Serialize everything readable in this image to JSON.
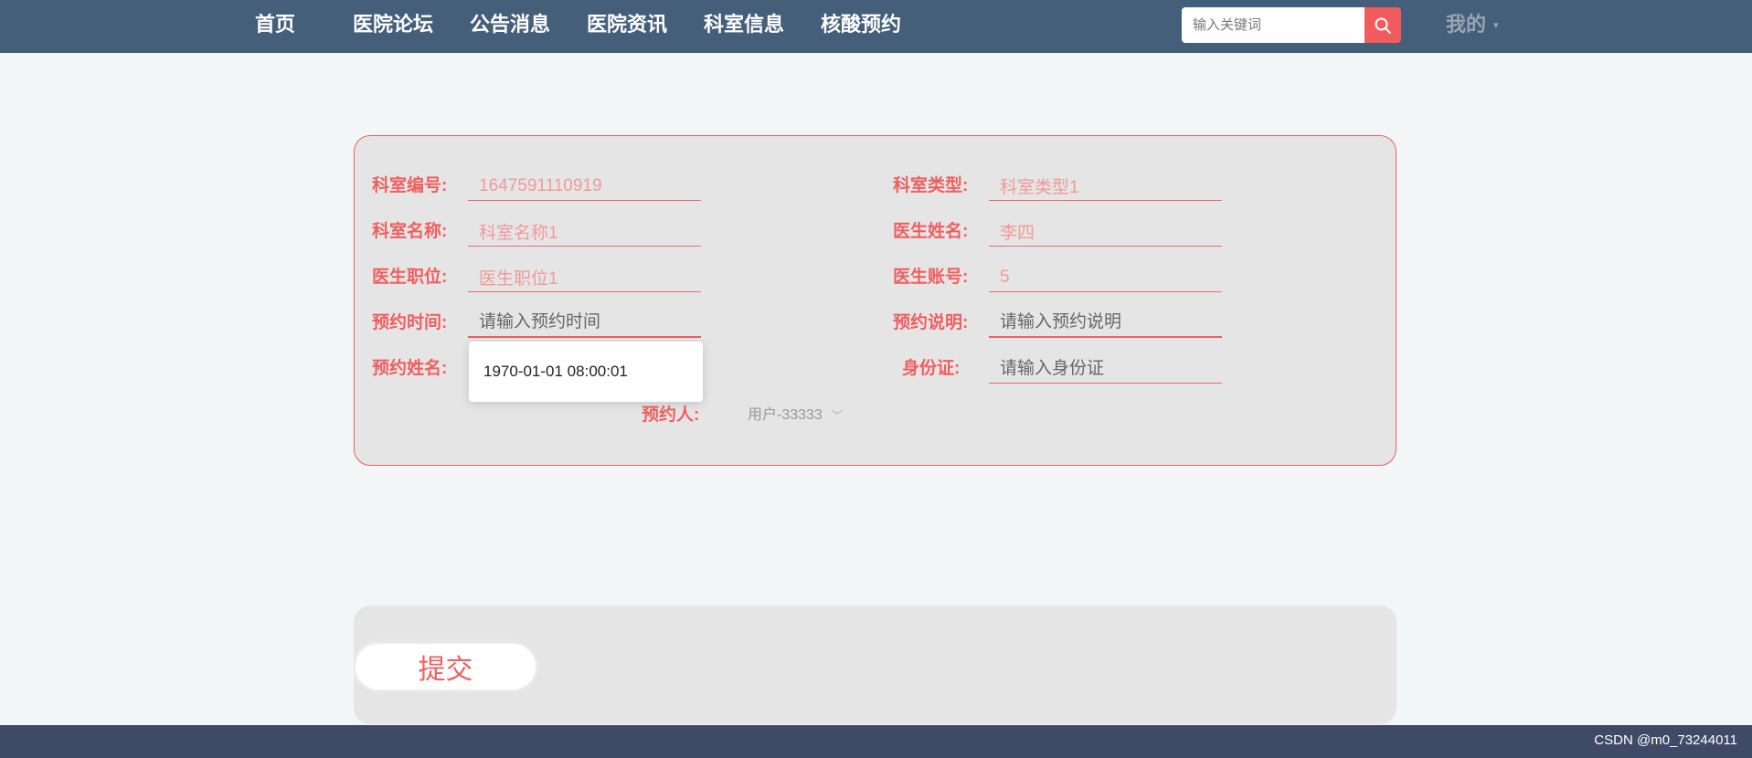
{
  "nav": {
    "items": [
      {
        "id": "home",
        "label": "首页"
      },
      {
        "id": "forum",
        "label": "医院论坛"
      },
      {
        "id": "notice",
        "label": "公告消息"
      },
      {
        "id": "news",
        "label": "医院资讯"
      },
      {
        "id": "department",
        "label": "科室信息"
      },
      {
        "id": "nucleic",
        "label": "核酸预约"
      }
    ],
    "search_placeholder": "输入关键词",
    "search_icon": "search-icon",
    "my_label": "我的",
    "my_caret": "▾"
  },
  "form": {
    "dept_no": {
      "label": "科室编号:",
      "value": "1647591110919"
    },
    "dept_type": {
      "label": "科室类型:",
      "value": "科室类型1"
    },
    "dept_name": {
      "label": "科室名称:",
      "value": "科室名称1"
    },
    "doctor_name": {
      "label": "医生姓名:",
      "value": "李四"
    },
    "doctor_title": {
      "label": "医生职位:",
      "value": "医生职位1"
    },
    "doctor_account": {
      "label": "医生账号:",
      "value": "5"
    },
    "appt_time": {
      "label": "预约时间:",
      "placeholder": "请输入预约时间"
    },
    "appt_desc": {
      "label": "预约说明:",
      "placeholder": "请输入预约说明"
    },
    "appt_name": {
      "label": "预约姓名:"
    },
    "id_card": {
      "label": "身份证:",
      "placeholder": "请输入身份证"
    },
    "appt_user": {
      "label": "预约人:",
      "value": "用户-33333",
      "chevron": "﹀"
    }
  },
  "date_popup": {
    "value": "1970-01-01 08:00:01"
  },
  "submit": {
    "label": "提交"
  },
  "watermark": "CSDN @m0_73244011"
}
